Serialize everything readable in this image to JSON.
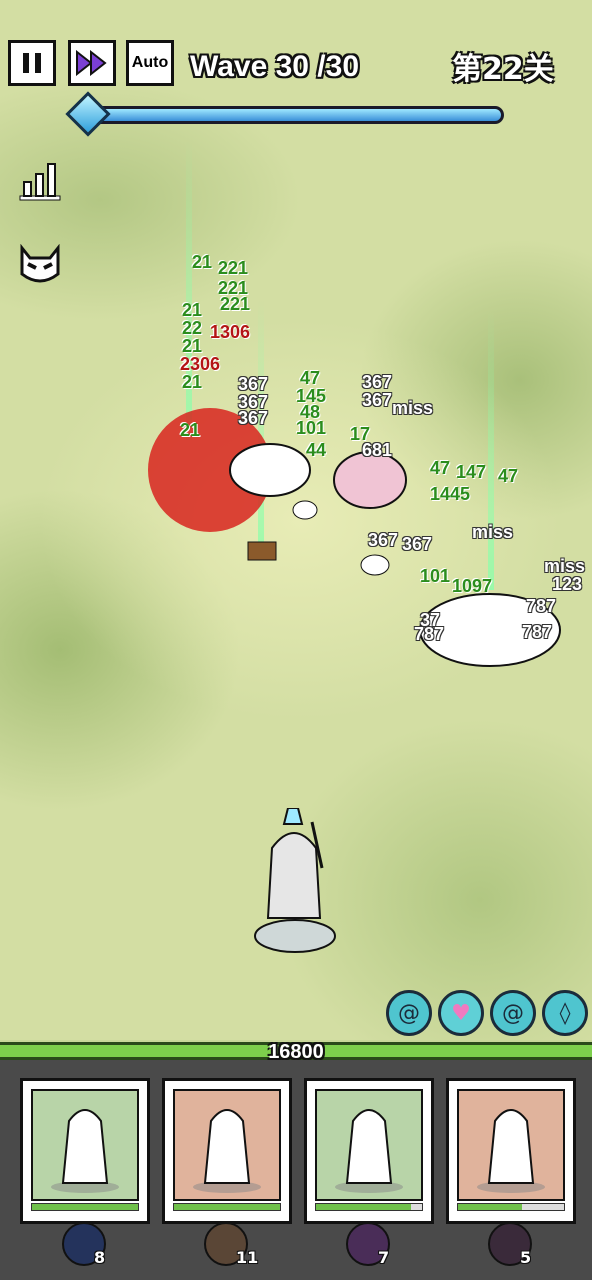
{
  "hud": {
    "pause_label": "⏸",
    "fast_forward_label": "▶▶",
    "auto_label": "Auto",
    "wave_text": "Wave 30 /30",
    "level_text": "第22关",
    "wave_progress": 1.0
  },
  "side": {
    "stats_icon": "bar-chart-icon",
    "monster_icon": "devil-face-icon"
  },
  "damage_numbers": [
    {
      "text": "21",
      "color": "g"
    },
    {
      "text": "221",
      "color": "g"
    },
    {
      "text": "221",
      "color": "g"
    },
    {
      "text": "221",
      "color": "g"
    },
    {
      "text": "21",
      "color": "g"
    },
    {
      "text": "1306",
      "color": "r"
    },
    {
      "text": "22",
      "color": "g"
    },
    {
      "text": "21",
      "color": "g"
    },
    {
      "text": "2306",
      "color": "r"
    },
    {
      "text": "21",
      "color": "g"
    },
    {
      "text": "367",
      "color": "w"
    },
    {
      "text": "367",
      "color": "w"
    },
    {
      "text": "367",
      "color": "w"
    },
    {
      "text": "21",
      "color": "g"
    },
    {
      "text": "47",
      "color": "g"
    },
    {
      "text": "145",
      "color": "g"
    },
    {
      "text": "48",
      "color": "g"
    },
    {
      "text": "101",
      "color": "g"
    },
    {
      "text": "367",
      "color": "w"
    },
    {
      "text": "367",
      "color": "w"
    },
    {
      "text": "miss",
      "color": "w"
    },
    {
      "text": "17",
      "color": "g"
    },
    {
      "text": "681",
      "color": "w"
    },
    {
      "text": "44",
      "color": "g"
    },
    {
      "text": "47",
      "color": "g"
    },
    {
      "text": "147",
      "color": "g"
    },
    {
      "text": "47",
      "color": "g"
    },
    {
      "text": "1445",
      "color": "g"
    },
    {
      "text": "367",
      "color": "w"
    },
    {
      "text": "367",
      "color": "w"
    },
    {
      "text": "miss",
      "color": "w"
    },
    {
      "text": "101",
      "color": "g"
    },
    {
      "text": "miss",
      "color": "w"
    },
    {
      "text": "123",
      "color": "w"
    },
    {
      "text": "1097",
      "color": "g"
    },
    {
      "text": "787",
      "color": "w"
    },
    {
      "text": "37",
      "color": "w"
    },
    {
      "text": "787",
      "color": "w"
    },
    {
      "text": "787",
      "color": "w"
    }
  ],
  "skills": [
    {
      "name": "swirl-skill-icon"
    },
    {
      "name": "heart-skill-icon"
    },
    {
      "name": "swirl-skill-icon"
    },
    {
      "name": "rune-skill-icon"
    }
  ],
  "base_hp": "16800",
  "base_hp_fraction": 1.0,
  "cards": [
    {
      "name": "armored-knight-card",
      "bg": "#b8d4a8",
      "progress": 1.0,
      "badge_color": "#24335c",
      "count": "8"
    },
    {
      "name": "hooded-assassin-card",
      "bg": "#e0b39c",
      "progress": 1.0,
      "badge_color": "#5a4636",
      "count": "11"
    },
    {
      "name": "swordsman-card",
      "bg": "#b8d4a8",
      "progress": 0.9,
      "badge_color": "#4a2d58",
      "count": "7"
    },
    {
      "name": "winged-demon-card",
      "bg": "#e0b39c",
      "progress": 0.6,
      "badge_color": "#3a2a3a",
      "count": "5"
    }
  ]
}
